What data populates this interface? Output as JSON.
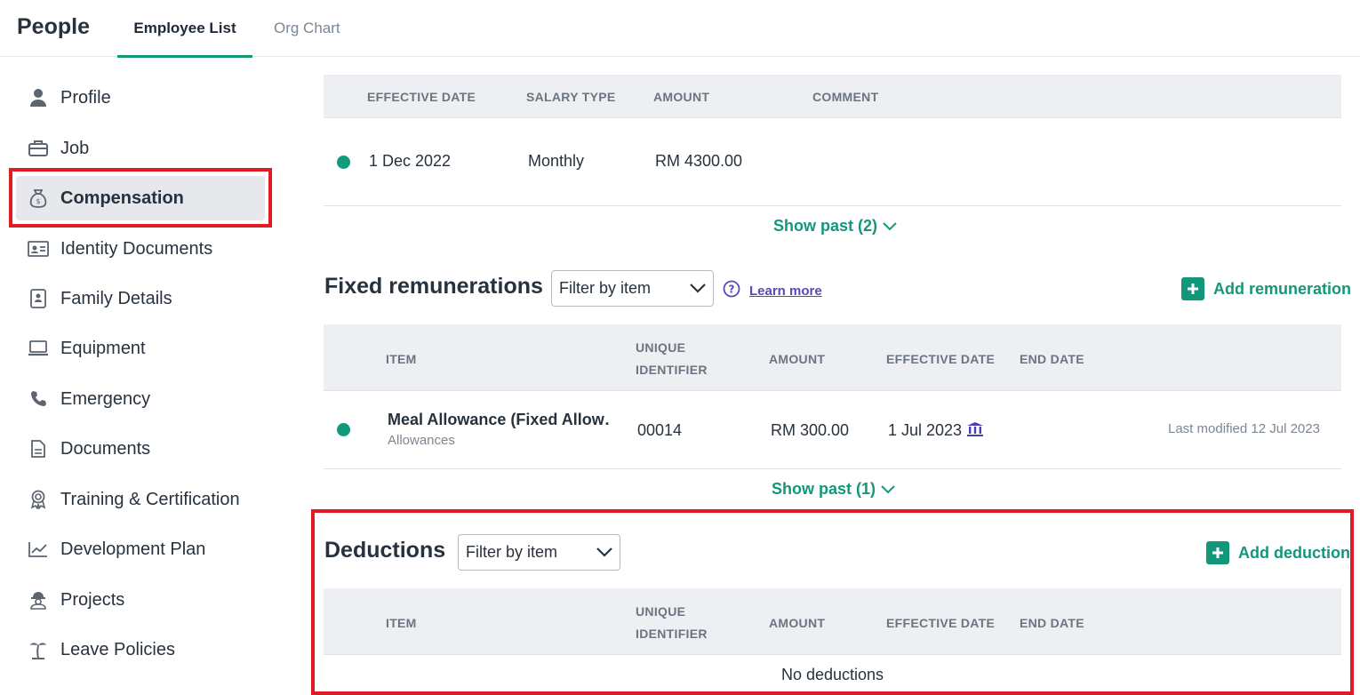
{
  "header": {
    "app_title": "People",
    "tabs": [
      {
        "label": "Employee List",
        "active": true
      },
      {
        "label": "Org Chart",
        "active": false
      }
    ]
  },
  "sidebar": {
    "items": [
      {
        "label": "Profile",
        "icon": "person-icon"
      },
      {
        "label": "Job",
        "icon": "briefcase-icon"
      },
      {
        "label": "Compensation",
        "icon": "money-bag-icon",
        "active": true
      },
      {
        "label": "Identity Documents",
        "icon": "id-card-icon"
      },
      {
        "label": "Family Details",
        "icon": "contact-book-icon"
      },
      {
        "label": "Equipment",
        "icon": "laptop-icon"
      },
      {
        "label": "Emergency",
        "icon": "phone-icon"
      },
      {
        "label": "Documents",
        "icon": "document-icon"
      },
      {
        "label": "Training & Certification",
        "icon": "award-icon"
      },
      {
        "label": "Development Plan",
        "icon": "trend-chart-icon"
      },
      {
        "label": "Projects",
        "icon": "worker-icon"
      },
      {
        "label": "Leave Policies",
        "icon": "palm-tree-icon"
      }
    ]
  },
  "salary": {
    "columns": [
      "EFFECTIVE DATE",
      "SALARY TYPE",
      "AMOUNT",
      "COMMENT"
    ],
    "rows": [
      {
        "effective_date": "1 Dec 2022",
        "salary_type": "Monthly",
        "amount": "RM 4300.00",
        "comment": ""
      }
    ],
    "show_past": "Show past (2)"
  },
  "fixed_remunerations": {
    "title": "Fixed remunerations",
    "filter_placeholder": "Filter by item",
    "learn_more": "Learn more",
    "add_label": "Add remuneration",
    "columns": {
      "item": "ITEM",
      "unique_identifier_1": "UNIQUE",
      "unique_identifier_2": "IDENTIFIER",
      "amount": "AMOUNT",
      "effective_date": "EFFECTIVE DATE",
      "end_date": "END DATE"
    },
    "rows": [
      {
        "item": "Meal Allowance (Fixed Allow…",
        "category": "Allowances",
        "unique_identifier": "00014",
        "amount": "RM 300.00",
        "effective_date": "1 Jul 2023",
        "end_date": "",
        "last_modified": "Last modified 12 Jul 2023"
      }
    ],
    "show_past": "Show past (1)"
  },
  "deductions": {
    "title": "Deductions",
    "filter_placeholder": "Filter by item",
    "add_label": "Add deduction",
    "columns": {
      "item": "ITEM",
      "unique_identifier_1": "UNIQUE",
      "unique_identifier_2": "IDENTIFIER",
      "amount": "AMOUNT",
      "effective_date": "EFFECTIVE DATE",
      "end_date": "END DATE"
    },
    "empty_text": "No deductions"
  },
  "colors": {
    "accent": "#12977a",
    "highlight": "#e01b24",
    "link": "#5b48b8"
  }
}
